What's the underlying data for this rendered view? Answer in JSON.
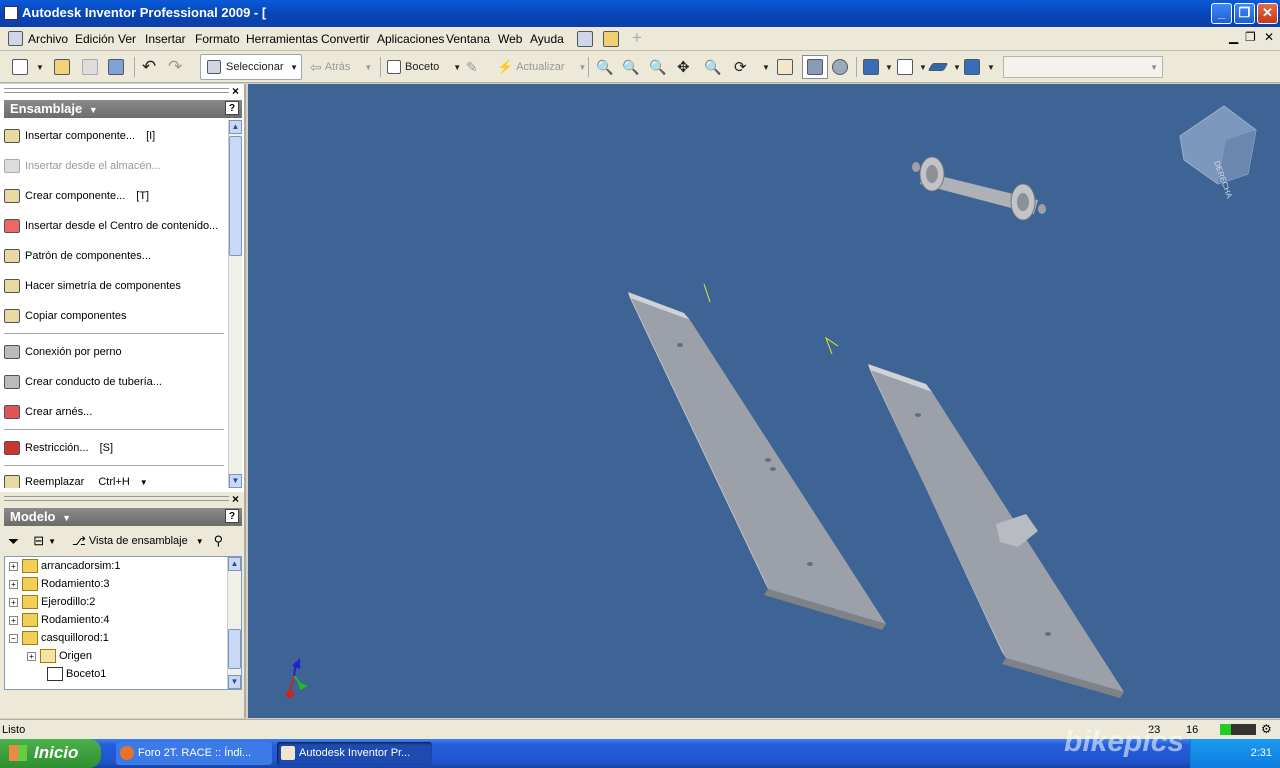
{
  "window": {
    "title": "Autodesk Inventor Professional 2009 - [",
    "minimize": "_",
    "restore": "❐",
    "close": "✕"
  },
  "menu": {
    "items": [
      "Archivo",
      "Edición",
      "Ver",
      "Insertar",
      "Formato",
      "Herramientas",
      "Convertir",
      "Aplicaciones",
      "Ventana",
      "Web",
      "Ayuda"
    ]
  },
  "toolbar": {
    "select_label": "Seleccionar",
    "back_label": "Atrás",
    "sketch_label": "Boceto",
    "update_label": "Actualizar"
  },
  "assembly_panel": {
    "title": "Ensamblaje",
    "help": "?",
    "close": "×",
    "commands": [
      {
        "label": "Insertar componente...",
        "shortcut": "[I]",
        "enabled": true
      },
      {
        "label": "Insertar desde el almacén...",
        "shortcut": "",
        "enabled": false
      },
      {
        "label": "Crear componente...",
        "shortcut": "[T]",
        "enabled": true
      },
      {
        "label": "Insertar desde el Centro de contenido...",
        "shortcut": "",
        "enabled": true
      },
      {
        "label": "Patrón de componentes...",
        "shortcut": "",
        "enabled": true
      },
      {
        "label": "Hacer simetría de componentes",
        "shortcut": "",
        "enabled": true
      },
      {
        "label": "Copiar componentes",
        "shortcut": "",
        "enabled": true
      },
      {
        "label": "Conexión por perno",
        "shortcut": "",
        "enabled": true
      },
      {
        "label": "Crear conducto de tubería...",
        "shortcut": "",
        "enabled": true
      },
      {
        "label": "Crear arnés...",
        "shortcut": "",
        "enabled": true
      },
      {
        "label": "Restricción...",
        "shortcut": "[S]",
        "enabled": true
      },
      {
        "label": "Reemplazar",
        "shortcut": "Ctrl+H",
        "enabled": true
      }
    ]
  },
  "model_panel": {
    "title": "Modelo",
    "help": "?",
    "close": "×",
    "view_label": "Vista de ensamblaje",
    "tree": [
      {
        "label": "arrancadorsim:1",
        "expander": "+"
      },
      {
        "label": "Rodamiento:3",
        "expander": "+"
      },
      {
        "label": "Ejerodillo:2",
        "expander": "+"
      },
      {
        "label": "Rodamiento:4",
        "expander": "+"
      },
      {
        "label": "casquillorod:1",
        "expander": "−"
      },
      {
        "label": "Origen",
        "expander": "+"
      },
      {
        "label": "Boceto1",
        "expander": ""
      }
    ]
  },
  "viewcube": {
    "face": "DERECHA"
  },
  "status": {
    "text": "Listo",
    "count_a": "23",
    "count_b": "16"
  },
  "taskbar": {
    "start_label": "Inicio",
    "tasks": [
      "Foro 2T. RACE :: Índi...",
      "Autodesk Inventor Pr..."
    ],
    "clock": "2:31"
  },
  "watermark": "bikepics",
  "colors": {
    "viewport": "#3d6494",
    "title_bar": "#0846b8",
    "taskbar": "#245edb"
  }
}
